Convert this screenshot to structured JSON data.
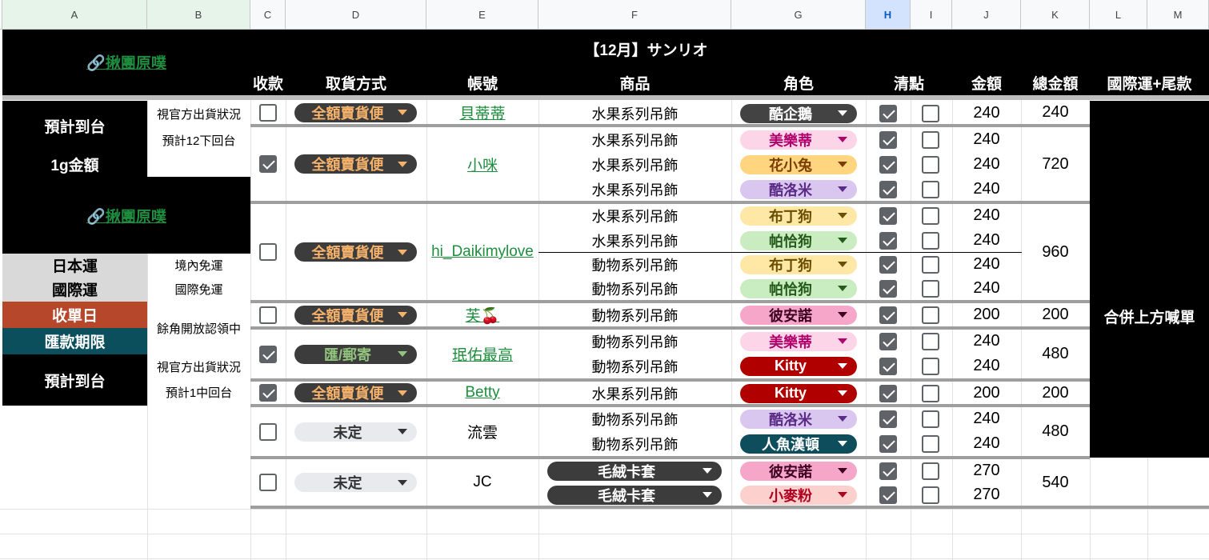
{
  "columns": [
    "A",
    "B",
    "C",
    "D",
    "E",
    "F",
    "G",
    "H",
    "I",
    "J",
    "K",
    "L",
    "M"
  ],
  "left": {
    "link1": "🔗揪團原噗",
    "link2": "🔗揪團原噗",
    "expected_arrival_1": "預計到台",
    "status_note_1": "視官方出貨狀況",
    "plan_1": "預計12下回台",
    "per_gram": "1g金額",
    "jp_ship": "日本運",
    "jp_ship_val": "境內免運",
    "intl_ship": "國際運",
    "intl_ship_val": "國際免運",
    "order_close": "收單日",
    "order_close_val": "餘角開放認領中",
    "pay_deadline": "匯款期限",
    "expected_arrival_2": "預計到台",
    "status_note_2": "視官方出貨狀況",
    "plan_2": "預計1中回台"
  },
  "header": {
    "title": "【12月】サンリオ",
    "col_paid": "收款",
    "col_pickup": "取貨方式",
    "col_account": "帳號",
    "col_item": "商品",
    "col_char": "角色",
    "col_check": "清點",
    "col_amount": "金額",
    "col_total": "總金額",
    "col_intl": "國際運+尾款"
  },
  "merge_note": "合併上方喊單",
  "orders": [
    {
      "paid": false,
      "pickup": "全額賣貨便",
      "account": "貝蒂蒂",
      "total": "240"
    },
    {
      "paid": true,
      "pickup": "全額賣貨便",
      "account": "小咪",
      "total": "720"
    },
    {
      "paid": false,
      "pickup": "全額賣貨便",
      "account": "hi_Daikimylove",
      "total": "960"
    },
    {
      "paid": false,
      "pickup": "全額賣貨便",
      "account": "芙🍒",
      "total": "200"
    },
    {
      "paid": true,
      "pickup": "匯/郵寄",
      "account": "珉佑最高",
      "total": "480"
    },
    {
      "paid": true,
      "pickup": "全額賣貨便",
      "account": "Betty",
      "total": "200"
    },
    {
      "paid": false,
      "pickup": "未定",
      "account": "流雲",
      "total": "480"
    },
    {
      "paid": false,
      "pickup": "未定",
      "account": "JC",
      "total": "540"
    }
  ],
  "items": [
    {
      "product": "水果系列吊飾",
      "char": "酷企鵝",
      "checked": true,
      "done": false,
      "amount": "240"
    },
    {
      "product": "水果系列吊飾",
      "char": "美樂蒂",
      "checked": true,
      "done": false,
      "amount": "240"
    },
    {
      "product": "水果系列吊飾",
      "char": "花小兔",
      "checked": true,
      "done": false,
      "amount": "240"
    },
    {
      "product": "水果系列吊飾",
      "char": "酷洛米",
      "checked": true,
      "done": false,
      "amount": "240"
    },
    {
      "product": "水果系列吊飾",
      "char": "布丁狗",
      "checked": true,
      "done": false,
      "amount": "240"
    },
    {
      "product": "水果系列吊飾",
      "char": "帕恰狗",
      "checked": true,
      "done": false,
      "amount": "240"
    },
    {
      "product": "動物系列吊飾",
      "char": "布丁狗",
      "checked": true,
      "done": false,
      "amount": "240"
    },
    {
      "product": "動物系列吊飾",
      "char": "帕恰狗",
      "checked": true,
      "done": false,
      "amount": "240"
    },
    {
      "product": "動物系列吊飾",
      "char": "彼安諾",
      "checked": true,
      "done": false,
      "amount": "200"
    },
    {
      "product": "動物系列吊飾",
      "char": "美樂蒂",
      "checked": true,
      "done": false,
      "amount": "240"
    },
    {
      "product": "動物系列吊飾",
      "char": "Kitty",
      "checked": true,
      "done": false,
      "amount": "240"
    },
    {
      "product": "水果系列吊飾",
      "char": "Kitty",
      "checked": true,
      "done": false,
      "amount": "200"
    },
    {
      "product": "動物系列吊飾",
      "char": "酷洛米",
      "checked": true,
      "done": false,
      "amount": "240"
    },
    {
      "product": "動物系列吊飾",
      "char": "人魚漢頓",
      "checked": true,
      "done": false,
      "amount": "240"
    },
    {
      "product": "毛絨卡套",
      "char": "彼安諾",
      "checked": true,
      "done": false,
      "amount": "270"
    },
    {
      "product": "毛絨卡套",
      "char": "小麥粉",
      "checked": true,
      "done": false,
      "amount": "270"
    }
  ],
  "colors": {
    "order_close": "#b7472a",
    "pay_deadline": "#0b4f5c",
    "link": "#1e8e3e"
  }
}
